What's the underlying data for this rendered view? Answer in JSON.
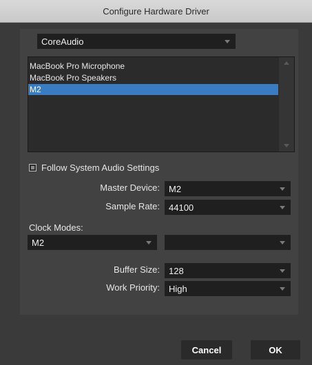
{
  "window": {
    "title": "Configure Hardware Driver"
  },
  "driver": {
    "selected": "CoreAudio"
  },
  "devices": {
    "items": [
      "MacBook Pro Microphone",
      "MacBook Pro Speakers",
      "M2"
    ],
    "selected": "M2"
  },
  "follow_system": {
    "label": "Follow System Audio Settings",
    "checked": false
  },
  "master_device": {
    "label": "Master Device:",
    "value": "M2"
  },
  "sample_rate": {
    "label": "Sample Rate:",
    "value": "44100"
  },
  "clock_modes": {
    "label": "Clock Modes:",
    "value_left": "M2",
    "value_right": ""
  },
  "buffer_size": {
    "label": "Buffer Size:",
    "value": "128"
  },
  "work_priority": {
    "label": "Work Priority:",
    "value": "High"
  },
  "buttons": {
    "cancel": "Cancel",
    "ok": "OK"
  },
  "colors": {
    "selection": "#3a7cc1",
    "panel": "#424242",
    "background": "#3a3a3a",
    "field": "#1f1f1f"
  }
}
